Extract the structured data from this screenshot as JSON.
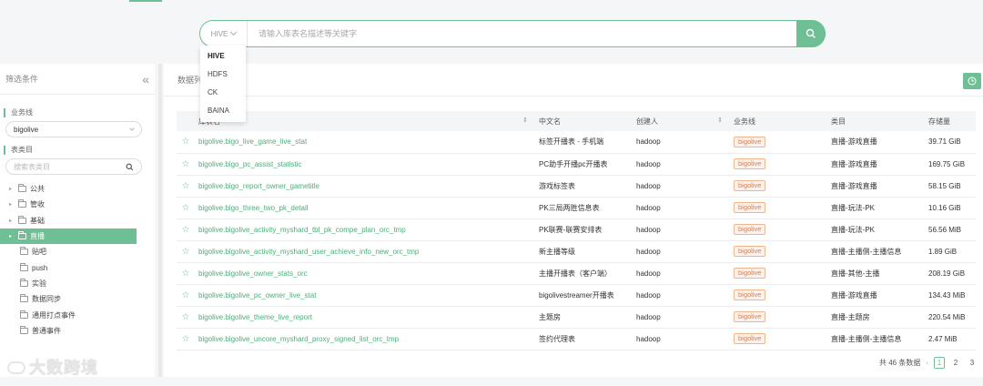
{
  "search": {
    "engine": "HIVE",
    "placeholder": "请输入库表名描述等关键字",
    "engines": [
      "HIVE",
      "HDFS",
      "CK",
      "BAINA"
    ]
  },
  "sidebar": {
    "title": "筛选条件",
    "business_label": "业务线",
    "business_value": "bigolive",
    "category_label": "表类目",
    "category_placeholder": "搜索表类目",
    "tree": [
      {
        "label": "公共",
        "expandable": true
      },
      {
        "label": "管收",
        "expandable": true
      },
      {
        "label": "基础",
        "expandable": true
      },
      {
        "label": "直播",
        "expandable": true,
        "active": true
      },
      {
        "label": "贴吧",
        "expandable": false
      },
      {
        "label": "push",
        "expandable": false
      },
      {
        "label": "实验",
        "expandable": false
      },
      {
        "label": "数据同步",
        "expandable": false
      },
      {
        "label": "通用打点事件",
        "expandable": false
      },
      {
        "label": "普通事件",
        "expandable": false
      }
    ]
  },
  "watermark": "大数跨境",
  "main": {
    "title": "数据列表",
    "columns": {
      "name": "库表名",
      "cn": "中文名",
      "owner": "创建人",
      "biz": "业务线",
      "cat": "类目",
      "size": "存储量"
    },
    "rows": [
      {
        "name": "bigolive.bigo_live_game_live_stat",
        "cn": "标签开播表 - 手机端",
        "owner": "hadoop",
        "biz": "bigolive",
        "cat": "直播-游戏直播",
        "size": "39.71 GiB"
      },
      {
        "name": "bigolive.bigo_pc_assist_statistic",
        "cn": "PC助手开播pc开播表",
        "owner": "hadoop",
        "biz": "bigolive",
        "cat": "直播-游戏直播",
        "size": "169.75 GiB"
      },
      {
        "name": "bigolive.bigo_report_owner_gametitle",
        "cn": "游戏标签表",
        "owner": "hadoop",
        "biz": "bigolive",
        "cat": "直播-游戏直播",
        "size": "58.15 GiB"
      },
      {
        "name": "bigolive.bigo_three_two_pk_detail",
        "cn": "PK三局两胜信息表",
        "owner": "hadoop",
        "biz": "bigolive",
        "cat": "直播-玩法-PK",
        "size": "10.16 GiB"
      },
      {
        "name": "bigolive.bigolive_activity_myshard_tbl_pk_compe_plan_orc_tmp",
        "cn": "PK联赛-联赛安排表",
        "owner": "hadoop",
        "biz": "bigolive",
        "cat": "直播-玩法-PK",
        "size": "56.56 MiB"
      },
      {
        "name": "bigolive.bigolive_activity_myshard_user_achieve_info_new_orc_tmp",
        "cn": "新主播等级",
        "owner": "hadoop",
        "biz": "bigolive",
        "cat": "直播-主播侧-主播信息",
        "size": "1.89 GiB"
      },
      {
        "name": "bigolive.bigolive_owner_stats_orc",
        "cn": "主播开播表（客户端）",
        "owner": "hadoop",
        "biz": "bigolive",
        "cat": "直播-其他-主播",
        "size": "208.19 GiB"
      },
      {
        "name": "bigolive.bigolive_pc_owner_live_stat",
        "cn": "bigolivestreamer开播表",
        "owner": "hadoop",
        "biz": "bigolive",
        "cat": "直播-游戏直播",
        "size": "134.43 MiB"
      },
      {
        "name": "bigolive.bigolive_theme_live_report",
        "cn": "主题房",
        "owner": "hadoop",
        "biz": "bigolive",
        "cat": "直播-主题房",
        "size": "220.54 MiB"
      },
      {
        "name": "bigolive.bigolive_uncore_myshard_proxy_signed_list_orc_tmp",
        "cn": "签约代理表",
        "owner": "hadoop",
        "biz": "bigolive",
        "cat": "直播-主播侧-主播信息",
        "size": "2.47 MiB"
      }
    ],
    "pagination": {
      "total_text": "共 46 条数据",
      "pages": [
        "1",
        "2",
        "3"
      ],
      "current": "1"
    }
  },
  "colors": {
    "accent": "#6fbf94",
    "link": "#4fae7a",
    "badge": "#e07a44"
  }
}
